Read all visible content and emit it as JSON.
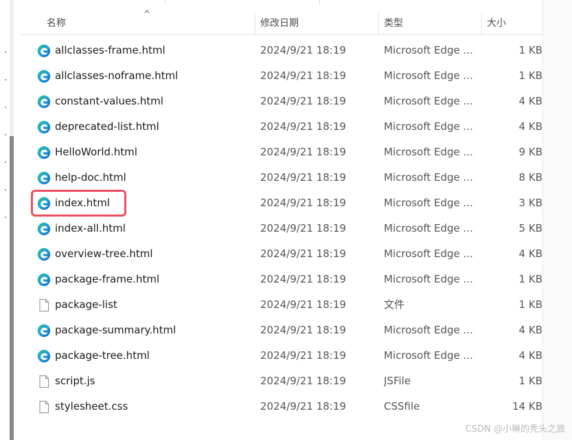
{
  "header": {
    "name": "名称",
    "date": "修改日期",
    "type": "类型",
    "size": "大小"
  },
  "files": [
    {
      "name": "allclasses-frame.html",
      "date": "2024/9/21 18:19",
      "type": "Microsoft Edge ...",
      "size": "1 KB",
      "icon": "edge-icon"
    },
    {
      "name": "allclasses-noframe.html",
      "date": "2024/9/21 18:19",
      "type": "Microsoft Edge ...",
      "size": "1 KB",
      "icon": "edge-icon"
    },
    {
      "name": "constant-values.html",
      "date": "2024/9/21 18:19",
      "type": "Microsoft Edge ...",
      "size": "4 KB",
      "icon": "edge-icon"
    },
    {
      "name": "deprecated-list.html",
      "date": "2024/9/21 18:19",
      "type": "Microsoft Edge ...",
      "size": "4 KB",
      "icon": "edge-icon"
    },
    {
      "name": "HelloWorld.html",
      "date": "2024/9/21 18:19",
      "type": "Microsoft Edge ...",
      "size": "9 KB",
      "icon": "edge-icon"
    },
    {
      "name": "help-doc.html",
      "date": "2024/9/21 18:19",
      "type": "Microsoft Edge ...",
      "size": "8 KB",
      "icon": "edge-icon"
    },
    {
      "name": "index.html",
      "date": "2024/9/21 18:19",
      "type": "Microsoft Edge ...",
      "size": "3 KB",
      "icon": "edge-icon"
    },
    {
      "name": "index-all.html",
      "date": "2024/9/21 18:19",
      "type": "Microsoft Edge ...",
      "size": "5 KB",
      "icon": "edge-icon"
    },
    {
      "name": "overview-tree.html",
      "date": "2024/9/21 18:19",
      "type": "Microsoft Edge ...",
      "size": "4 KB",
      "icon": "edge-icon"
    },
    {
      "name": "package-frame.html",
      "date": "2024/9/21 18:19",
      "type": "Microsoft Edge ...",
      "size": "1 KB",
      "icon": "edge-icon"
    },
    {
      "name": "package-list",
      "date": "2024/9/21 18:19",
      "type": "文件",
      "size": "1 KB",
      "icon": "file-icon"
    },
    {
      "name": "package-summary.html",
      "date": "2024/9/21 18:19",
      "type": "Microsoft Edge ...",
      "size": "4 KB",
      "icon": "edge-icon"
    },
    {
      "name": "package-tree.html",
      "date": "2024/9/21 18:19",
      "type": "Microsoft Edge ...",
      "size": "4 KB",
      "icon": "edge-icon"
    },
    {
      "name": "script.js",
      "date": "2024/9/21 18:19",
      "type": "JSFile",
      "size": "1 KB",
      "icon": "file-icon"
    },
    {
      "name": "stylesheet.css",
      "date": "2024/9/21 18:19",
      "type": "CSSfile",
      "size": "14 KB",
      "icon": "file-icon"
    }
  ],
  "highlighted_file": "index.html",
  "watermark": "CSDN @小琳的秃头之旅",
  "colors": {
    "highlight": "#ec4d5f",
    "edge_blue": "#0f78d4",
    "edge_green": "#37c481"
  }
}
